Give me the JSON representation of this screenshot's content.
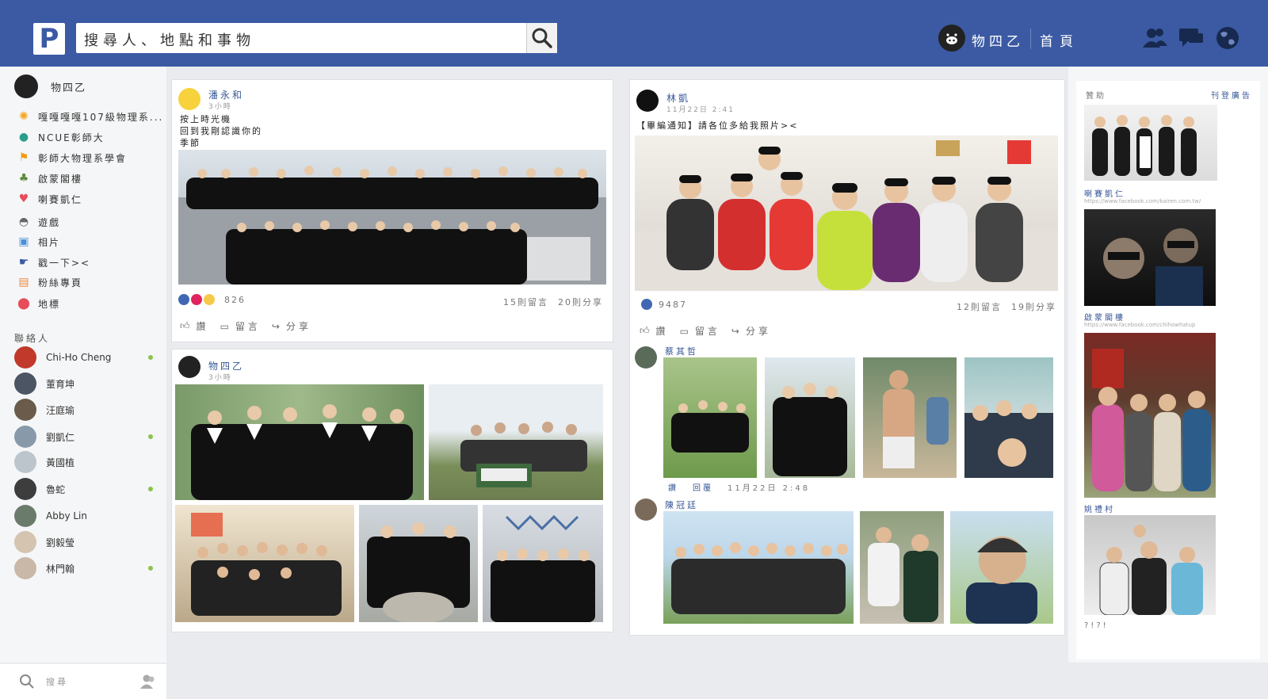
{
  "header": {
    "logo": "P",
    "search_placeholder": "搜尋人、地點和事物",
    "profile_name": "物四乙",
    "home": "首頁"
  },
  "sidebar": {
    "profile": "物四乙",
    "items": [
      {
        "label": "嘎嘎嘎嘎107級物理系...",
        "icon": "sun-icon"
      },
      {
        "label": "NCUE彰師大",
        "icon": "globe-icon"
      },
      {
        "label": "彰師大物理系學會",
        "icon": "flag-icon"
      },
      {
        "label": "啟蒙閣樓",
        "icon": "tree-icon"
      },
      {
        "label": "喇賽凱仁",
        "icon": "heart-icon"
      },
      {
        "label": "遊戲",
        "icon": "gamepad-icon"
      },
      {
        "label": "相片",
        "icon": "photo-icon"
      },
      {
        "label": "戳一下><",
        "icon": "poke-icon"
      },
      {
        "label": "粉絲專頁",
        "icon": "page-icon"
      },
      {
        "label": "地標",
        "icon": "pin-icon"
      }
    ],
    "contacts_title": "聯絡人",
    "contacts": [
      {
        "name": "Chi-Ho Cheng",
        "online": true
      },
      {
        "name": "董育坤",
        "online": false
      },
      {
        "name": "汪庭瑜",
        "online": false
      },
      {
        "name": "劉凱仁",
        "online": true
      },
      {
        "name": "黃國植",
        "online": false
      },
      {
        "name": "魯蛇",
        "online": true
      },
      {
        "name": "Abby Lin",
        "online": false
      },
      {
        "name": "劉毅瑩",
        "online": false
      },
      {
        "name": "林門翰",
        "online": true
      }
    ],
    "chat_search": "搜尋"
  },
  "posts": {
    "p1": {
      "author": "潘永和",
      "time": "3小時",
      "text1": "按上時光機",
      "text2": "回到我剛認識你的",
      "text3": "季節",
      "reactions_count": "826",
      "comments": "15則留言",
      "shares": "20則分享",
      "like": "讚",
      "comment": "留言",
      "share": "分享"
    },
    "p2": {
      "author": "物四乙",
      "time": "3小時"
    },
    "p3": {
      "author": "林凱",
      "time": "11月22日 2:41",
      "text": "【畢編通知】請各位多給我照片><",
      "reactions_count": "9487",
      "comments": "12則留言",
      "shares": "19則分享",
      "like": "讚",
      "comment": "留言",
      "share": "分享",
      "c1_name": "蔡其哲",
      "c1_like": "讚",
      "c1_reply": "回覆",
      "c1_time": "11月22日 2:48",
      "c2_name": "陳冠廷"
    }
  },
  "right": {
    "sponsored": "贊助",
    "create_ad": "刊登廣告",
    "ad1_name": "喇賽凱仁",
    "ad1_url": "https://www.facebook.com/kairen.com.tw/",
    "ad2_name": "啟蒙閣樓",
    "ad2_url": "https://www.facebook.com/chihowhatup",
    "ad3_name": "姚禮村",
    "footer": "?!?!"
  },
  "colors": {
    "brand": "#3b5aa3",
    "link": "#385898",
    "online": "#8bc34a"
  }
}
